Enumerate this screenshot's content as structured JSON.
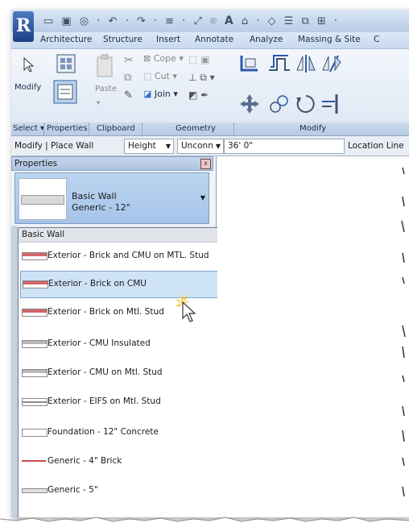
{
  "app": {
    "logo_letter": "R",
    "accent": "#2c5aa8"
  },
  "ribbon_tabs": [
    "Architecture",
    "Structure",
    "Insert",
    "Annotate",
    "Analyze",
    "Massing & Site",
    "C"
  ],
  "ribbon": {
    "modify_label": "Modify",
    "paste_label": "Paste",
    "cope_label": "Cope",
    "cut_label": "Cut",
    "join_label": "Join",
    "panels": {
      "select": "Select",
      "properties": "Properties",
      "clipboard": "Clipboard",
      "geometry": "Geometry",
      "modify": "Modify"
    }
  },
  "options_bar": {
    "context": "Modify | Place Wall",
    "height_label": "Height",
    "unconn_label": "Unconn",
    "height_value": "36'  0\"",
    "location_label": "Location Line"
  },
  "properties": {
    "title": "Properties",
    "close_glyph": "x",
    "type_family": "Basic Wall",
    "type_name": "Generic - 12\"",
    "dropdown": {
      "group_header": "Basic Wall",
      "items": [
        {
          "label": "Exterior - Brick and CMU on MTL. Stud",
          "color": "#d0666b"
        },
        {
          "label": "Exterior - Brick on CMU",
          "color": "#d0666b",
          "selected": true
        },
        {
          "label": "Exterior - Brick on Mtl. Stud",
          "color": "#d0666b"
        },
        {
          "label": "Exterior - CMU Insulated",
          "color": "#b8b8b8"
        },
        {
          "label": "Exterior - CMU on Mtl. Stud",
          "color": "#b8b8b8"
        },
        {
          "label": "Exterior - EIFS on Mtl. Stud",
          "color": "#8f8f8f"
        },
        {
          "label": "Foundation - 12\" Concrete",
          "color": "#ffffff"
        },
        {
          "label": "Generic - 4\" Brick",
          "color": "#c84a4a"
        },
        {
          "label": "Generic - 5\"",
          "color": "#d6d6d6"
        }
      ]
    }
  }
}
